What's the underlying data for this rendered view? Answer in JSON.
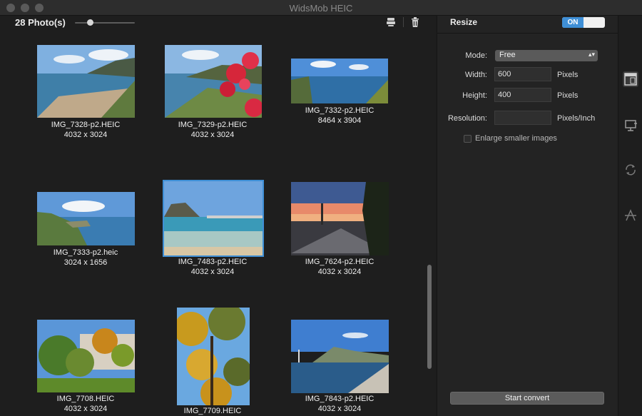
{
  "window": {
    "title": "WidsMob HEIC"
  },
  "toolbar": {
    "photo_count": "28 Photo(s)",
    "icons": [
      "stack-icon",
      "trash-icon"
    ]
  },
  "photos": [
    {
      "name": "IMG_7328-p2.HEIC",
      "dims": "4032 x 3024"
    },
    {
      "name": "IMG_7329-p2.HEIC",
      "dims": "4032 x 3024"
    },
    {
      "name": "IMG_7332-p2.HEIC",
      "dims": "8464 x 3904"
    },
    {
      "name": "IMG_7333-p2.heic",
      "dims": "3024 x 1656"
    },
    {
      "name": "IMG_7483-p2.HEIC",
      "dims": "4032 x 3024",
      "selected": true
    },
    {
      "name": "IMG_7624-p2.HEIC",
      "dims": "4032 x 3024"
    },
    {
      "name": "IMG_7708.HEIC",
      "dims": "4032 x 3024"
    },
    {
      "name": "IMG_7709.HEIC",
      "dims": ""
    },
    {
      "name": "IMG_7843-p2.HEIC",
      "dims": "4032 x 3024"
    }
  ],
  "settings": {
    "section_title": "Resize",
    "toggle_label": "ON",
    "mode_label": "Mode:",
    "mode_value": "Free",
    "width_label": "Width:",
    "width_value": "600",
    "width_unit": "Pixels",
    "height_label": "Height:",
    "height_value": "400",
    "height_unit": "Pixels",
    "resolution_label": "Resolution:",
    "resolution_value": "",
    "resolution_unit": "Pixels/Inch",
    "enlarge_label": "Enlarge smaller images",
    "enlarge_checked": false,
    "start_button": "Start convert"
  },
  "side_toolbar": [
    "resize-icon",
    "crop-icon",
    "rotate-icon",
    "watermark-icon"
  ],
  "colors": {
    "accent": "#3f8fd6",
    "background": "#1e1e1e",
    "panel": "#232323"
  }
}
